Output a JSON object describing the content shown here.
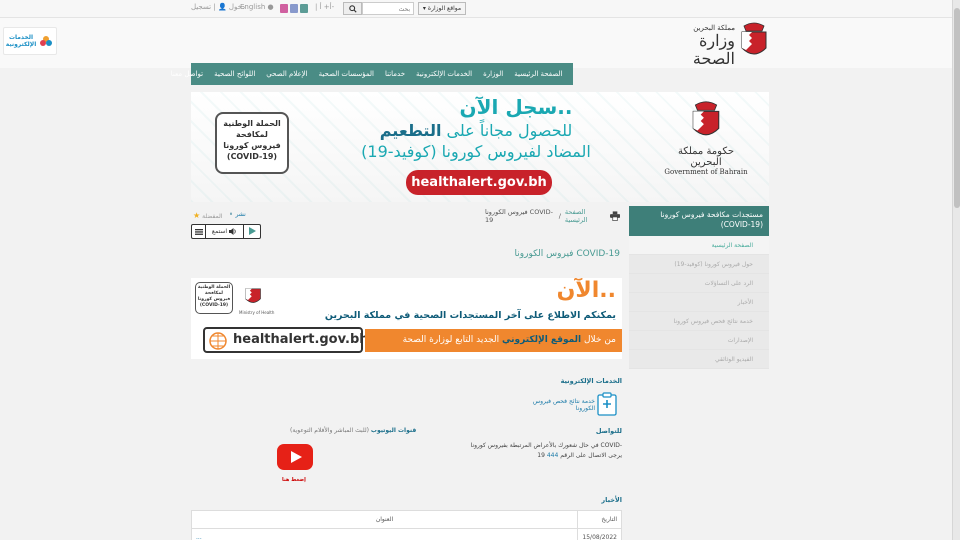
{
  "topbar": {
    "sites_label": "مواقع الوزارة",
    "search_placeholder": "بحث",
    "font_controls": "| أ+ أ-",
    "language": "English",
    "login": "دخول",
    "register": "تسجيل",
    "separator": "|",
    "contrast_colors": [
      "#d060a0",
      "#8899cc",
      "#5c9c96",
      "#3a7f9a"
    ]
  },
  "header": {
    "logo_small": "مملكة البحرين",
    "logo_big": "وزارة الصحة",
    "eservices_line1": "الخدمات",
    "eservices_line2": "الإلكترونية"
  },
  "nav": {
    "items": [
      "الصفحة الرئيسية",
      "الوزارة",
      "الخدمات الإلكترونية",
      "خدماتنا",
      "المؤسسات الصحية",
      "الإعلام الصحي",
      "اللوائح الصحية",
      "تواصل معنا"
    ]
  },
  "banner": {
    "line1": "سجل الآن..",
    "line2_prefix": "للحصول مجاناً على",
    "line2_bold": "التطعيم",
    "line3": "المضاد لفيروس كورونا (كوفيد-19)",
    "url": "healthalert.gov.bh",
    "campaign": [
      "الحملة الوطنية",
      "لمكافحة",
      "فيروس كورونا",
      "(COVID-19)"
    ],
    "gov_name_ar": "حكومة مملكة البحرين",
    "gov_name_en": "Government of Bahrain"
  },
  "sidebar": {
    "heading": "مستجدات مكافحة فيروس كورونا (COVID-19)",
    "items": [
      "الصفحة الرئيسية",
      "حول فيروس كورونا (كوفيد-19)",
      "الرد على التساؤلات",
      "الأخبار",
      "خدمة نتائج فحص فيروس كورونا",
      "الإصدارات",
      "الفيديو الوثائقي"
    ]
  },
  "breadcrumb": {
    "home": "الصفحة الرئيسية",
    "separator": "/",
    "current": "فيروس الكورونا COVID-19"
  },
  "share": {
    "share_label": "نشر",
    "favorite_label": "المفضلة"
  },
  "player": {
    "listen_label": "استمع"
  },
  "content": {
    "title": "فيروس الكورونا COVID-19",
    "banner2": {
      "now": "الآن..",
      "line": "يمكنكم الاطلاع على آخر المستجدات الصحية في مملكة البحرين",
      "url": "healthalert.gov.bh",
      "orange_prefix": "من خلال",
      "orange_bold": "الموقع الإلكتروني",
      "orange_suffix": "الجديد التابع لوزارة الصحة",
      "small_box": [
        "الحملة الوطنية",
        "لمكافحة",
        "فيروس كورونا",
        "(COVID-19)"
      ],
      "ministry": "Ministry of Health"
    },
    "eservices_title": "الخدمات الإلكترونية",
    "service_link": "خدمة نتائج فحص فيروس الكورونا",
    "contact_title": "للتواصل",
    "contact_text": "في حال شعورك بالأعراض المرتبطة بفيروس كورونا COVID-19 يرجى الاتصال على الرقم",
    "contact_number": "444",
    "youtube_title_bold": "قنوات اليوتيوب",
    "youtube_title_rest": "(للبث المباشر والأفلام التوعوية)",
    "youtube_click": "إضغط هنا",
    "news_title": "الأخبار",
    "table": {
      "col_date": "التاريخ",
      "col_title": "العنوان",
      "row1_date": "15/08/2022",
      "row1_title": "..."
    }
  }
}
